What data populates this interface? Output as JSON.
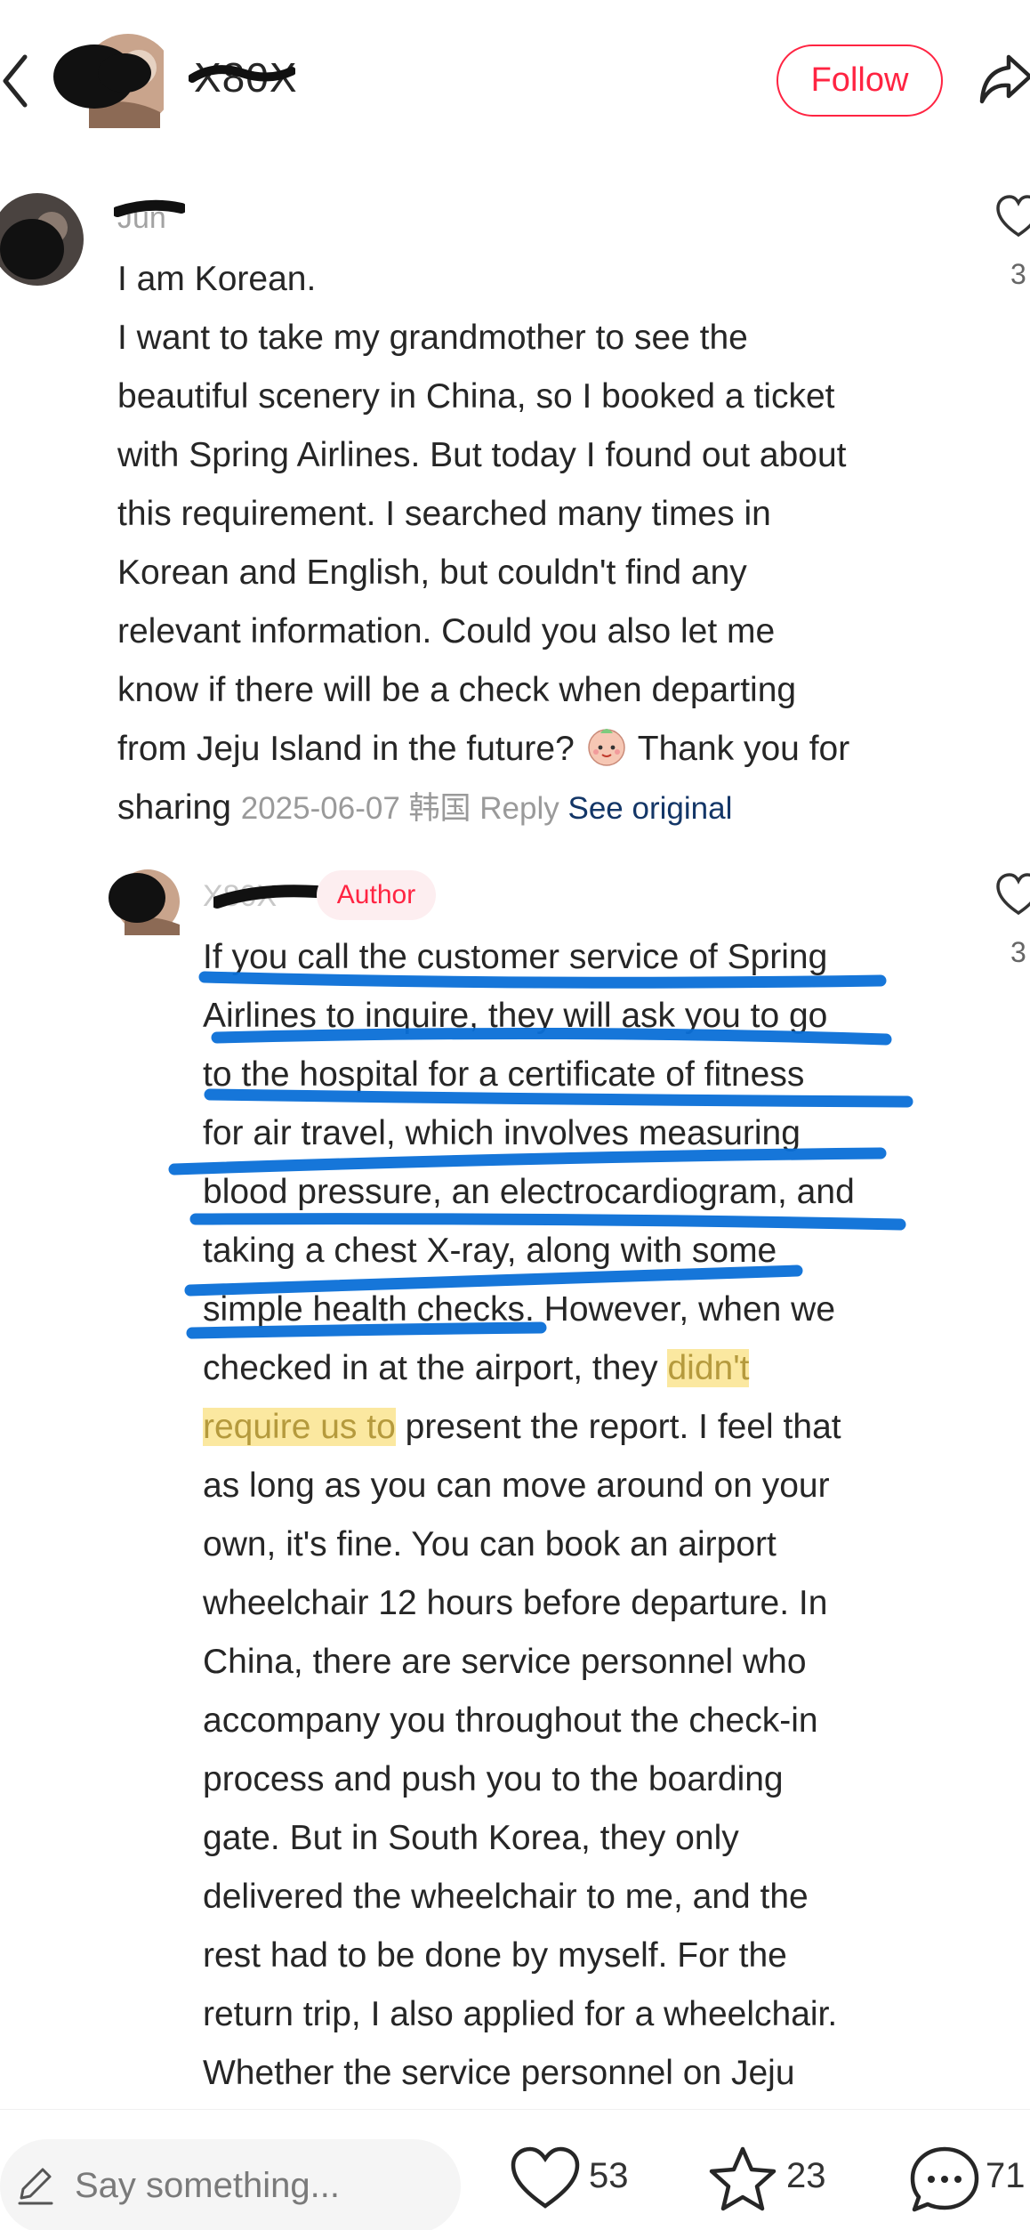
{
  "header": {
    "username": "X80X",
    "follow_label": "Follow"
  },
  "comment": {
    "username": "Jun",
    "text_lines": [
      "I am Korean.",
      "I want to take my grandmother to see the",
      "beautiful scenery in China, so I booked a ticket",
      "with Spring Airlines. But today I found out about",
      "this requirement. I searched many times in",
      "Korean and English, but couldn't find any",
      "relevant information. Could you also let me",
      "know if there will be a check when departing"
    ],
    "last_line_a": "from Jeju Island in the future? ",
    "last_line_b": " Thank you for",
    "final_word": "sharing ",
    "date": "2025-06-07",
    "location": "韩国",
    "reply_label": "Reply",
    "see_original_label": "See original",
    "like_count": "3"
  },
  "reply": {
    "username": "X80X",
    "author_badge": "Author",
    "like_count": "3",
    "lines": [
      "If you call the customer service of Spring",
      "Airlines to inquire, they will ask you to go",
      "to the hospital for a certificate of fitness",
      "for air travel, which involves measuring",
      "blood pressure, an electrocardiogram, and",
      "taking a chest X-ray, along with some"
    ],
    "line7": "simple health checks. However, when we",
    "line8_a": "checked in at the airport, they ",
    "line8_hl": "didn't",
    "line9_hl": "require us to",
    "line9_b": " present the report. I feel that",
    "rest_lines": [
      "as long as you can move around on your",
      "own, it's fine. You can book an airport",
      "wheelchair 12 hours before departure. In",
      "China, there are service personnel who",
      "accompany you throughout the check-in",
      "process and push you to the boarding",
      "gate. But in South Korea, they only",
      "delivered the wheelchair to me, and the",
      "rest had to be done by myself. For the",
      "return trip, I also applied for a wheelchair.",
      "Whether the service personnel on Jeju"
    ]
  },
  "bottom_bar": {
    "placeholder": "Say something...",
    "likes": "53",
    "stars": "23",
    "comments": "71"
  },
  "colors": {
    "accent": "#ff2442",
    "link": "#133667",
    "highlight": "#fbe8a0",
    "pen": "#0a6fd8"
  }
}
